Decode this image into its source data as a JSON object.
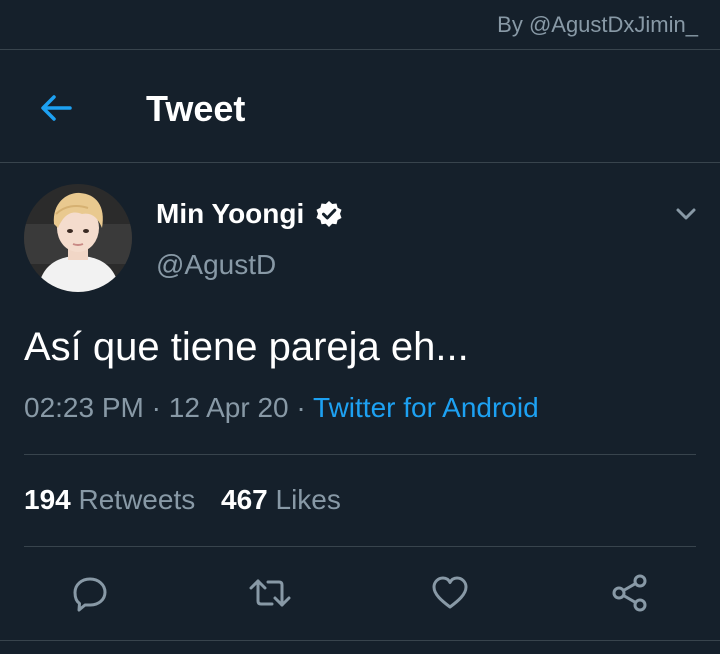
{
  "credit": "By @AgustDxJimin_",
  "header": {
    "title": "Tweet",
    "back_icon": "arrow-left-icon"
  },
  "tweet": {
    "author": {
      "name": "Min Yoongi",
      "handle": "@AgustD",
      "verified": true
    },
    "text": "Así que tiene pareja eh...",
    "time": "02:23 PM",
    "date": "12 Apr 20",
    "separator": "·",
    "source": "Twitter for Android",
    "retweets_count": "194",
    "retweets_label": "Retweets",
    "likes_count": "467",
    "likes_label": "Likes"
  },
  "actions": [
    "reply-icon",
    "retweet-icon",
    "like-icon",
    "share-icon"
  ],
  "colors": {
    "background": "#15202b",
    "divider": "#38444d",
    "secondary_text": "#8899a6",
    "accent": "#1da1f2",
    "primary_text": "#ffffff"
  }
}
